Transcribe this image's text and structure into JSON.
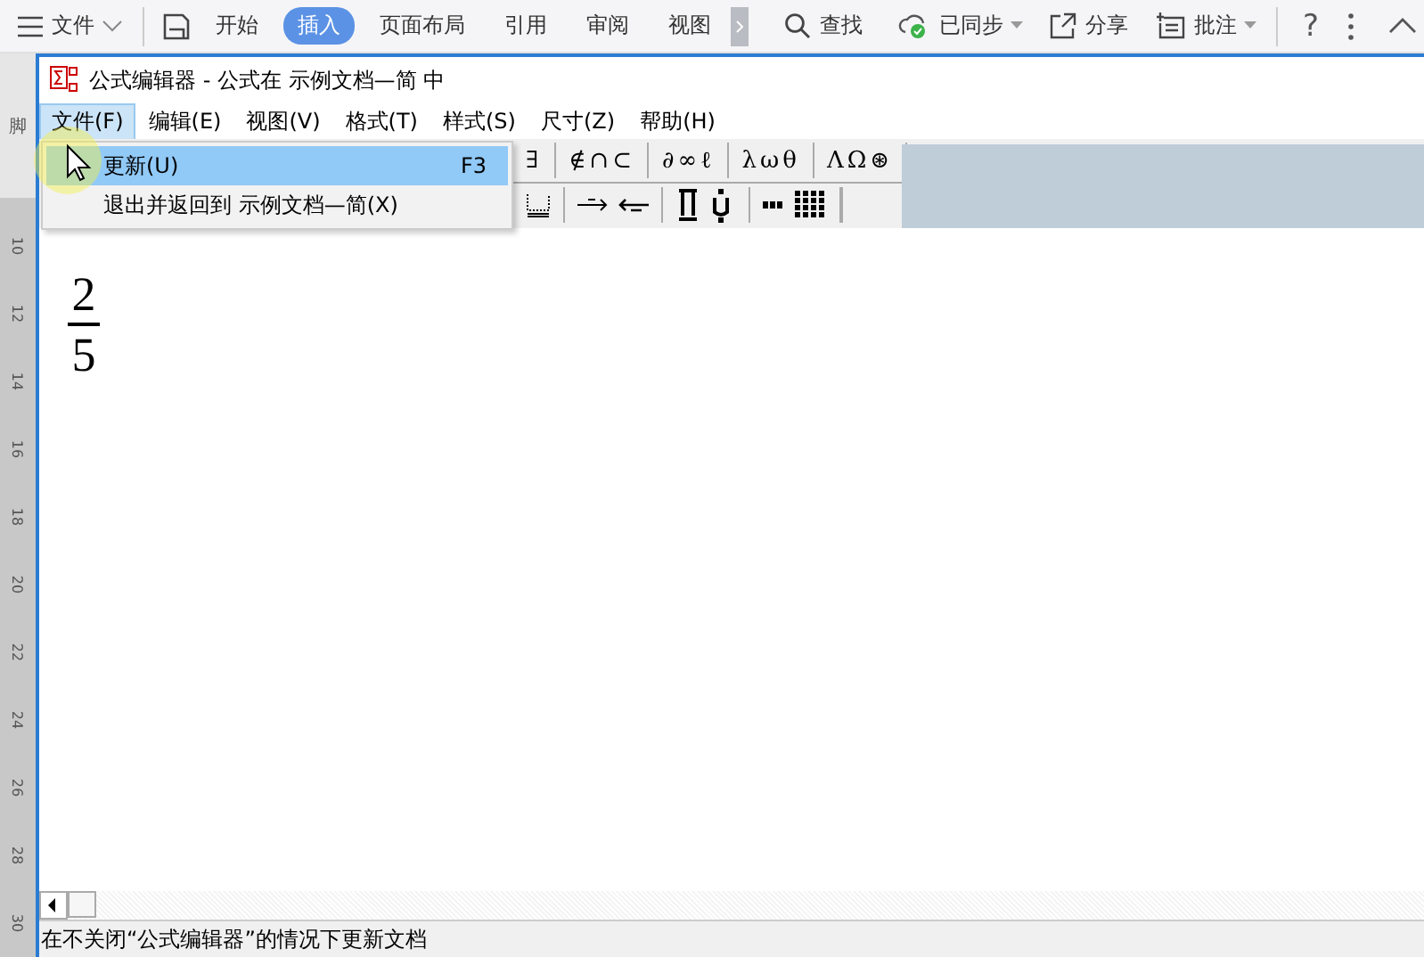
{
  "top_bar": {
    "file_menu": "文件",
    "tabs": [
      {
        "label": "开始",
        "selected": false
      },
      {
        "label": "插入",
        "selected": true
      },
      {
        "label": "页面布局",
        "selected": false
      },
      {
        "label": "引用",
        "selected": false
      },
      {
        "label": "审阅",
        "selected": false
      },
      {
        "label": "视图",
        "selected": false
      }
    ],
    "search": "查找",
    "sync": "已同步",
    "share": "分享",
    "comment": "批注",
    "help": "?"
  },
  "ruler": {
    "side_tab": "脚",
    "marks": [
      "10",
      "12",
      "14",
      "16",
      "18",
      "20",
      "22",
      "24",
      "26",
      "28",
      "30"
    ]
  },
  "window": {
    "title": "公式编辑器 - 公式在 示例文档—简 中"
  },
  "menu": [
    {
      "label": "文件(F)",
      "selected": true
    },
    {
      "label": "编辑(E)",
      "selected": false
    },
    {
      "label": "视图(V)",
      "selected": false
    },
    {
      "label": "格式(T)",
      "selected": false
    },
    {
      "label": "样式(S)",
      "selected": false
    },
    {
      "label": "尺寸(Z)",
      "selected": false
    },
    {
      "label": "帮助(H)",
      "selected": false
    }
  ],
  "dropdown": [
    {
      "label": "更新(U)",
      "shortcut": "F3",
      "selected": true
    },
    {
      "label": "退出并返回到 示例文档—简(X)",
      "selected": false
    }
  ],
  "symbol_palette": [
    "∃",
    "∉∩⊂",
    "∂∞ℓ",
    "λωθ",
    "ΛΩ⊛"
  ],
  "equation": {
    "numerator": "2",
    "denominator": "5"
  },
  "status_bar": "在不关闭“公式编辑器”的情况下更新文档"
}
